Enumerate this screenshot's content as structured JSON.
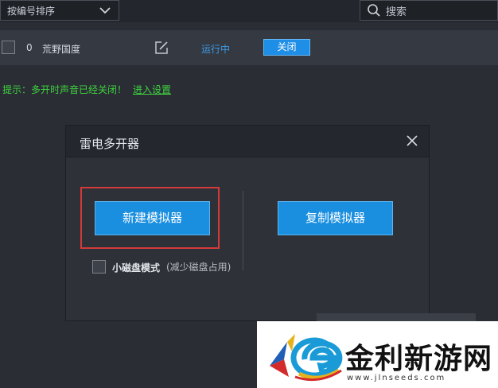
{
  "toolbar": {
    "sort_label": "按编号排序",
    "search_placeholder": "搜索"
  },
  "instance": {
    "index": "0",
    "name": "荒野国度",
    "status": "运行中",
    "close_label": "关闭"
  },
  "hint": {
    "text": "提示：多开时声音已经关闭！",
    "link": "进入设置"
  },
  "dialog": {
    "title": "雷电多开器",
    "new_label": "新建模拟器",
    "copy_label": "复制模拟器",
    "small_disk_label": "小磁盘模式",
    "small_disk_note": "(减少磁盘占用)"
  },
  "watermark": {
    "text": "金利新游网",
    "url": "www.jlnseeds.com"
  },
  "colors": {
    "accent": "#1a8fe0",
    "hint_green": "#3fd23f",
    "highlight_red": "#d43a3a",
    "status_blue": "#3b9ae6"
  }
}
